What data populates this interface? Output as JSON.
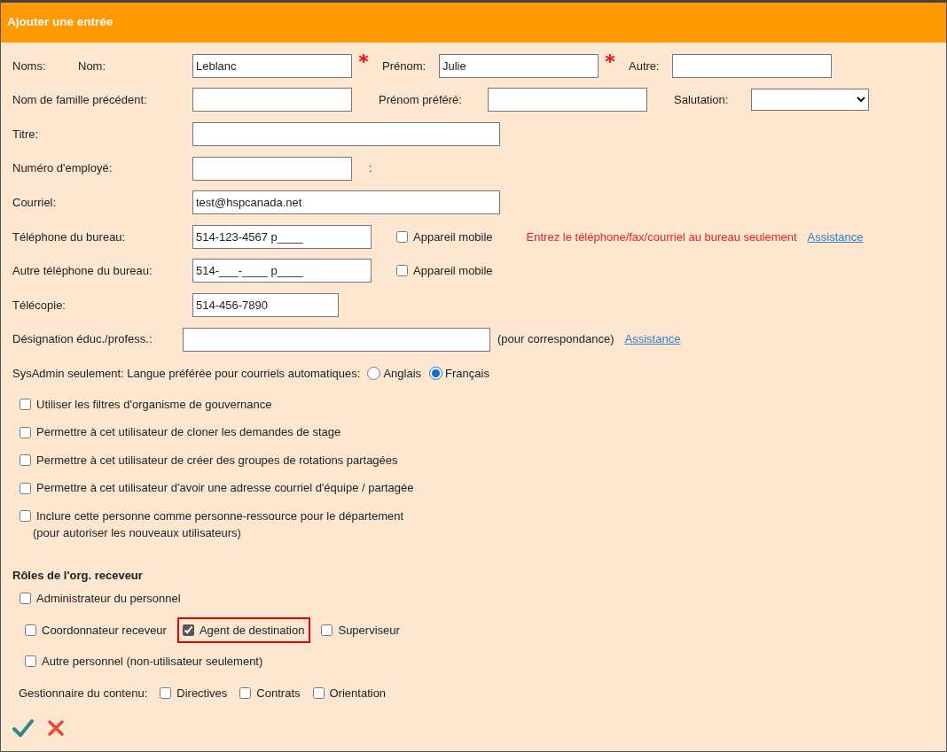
{
  "window": {
    "title": "Ajouter une entrée"
  },
  "rows": [
    {
      "items": [
        {
          "kind": "label",
          "text": "Noms:"
        },
        {
          "kind": "label",
          "text": "Nom:"
        },
        {
          "kind": "input",
          "value": "Leblanc",
          "required": true
        },
        {
          "kind": "label",
          "text": "Prénom:"
        },
        {
          "kind": "input",
          "value": "Julie",
          "required": true
        },
        {
          "kind": "label",
          "text": "Autre:"
        },
        {
          "kind": "input"
        }
      ]
    },
    {
      "items": [
        {
          "kind": "label",
          "text": "Nom de famille précédent:"
        },
        {
          "kind": "input"
        },
        {
          "kind": "label",
          "text": "Prénom préféré:"
        },
        {
          "kind": "input"
        },
        {
          "kind": "label",
          "text": "Salutation:"
        },
        {
          "kind": "select"
        }
      ]
    },
    {
      "items": [
        {
          "kind": "label",
          "text": "Titre:"
        },
        {
          "kind": "input"
        }
      ]
    },
    {
      "items": [
        {
          "kind": "label",
          "text": "Numéro d'employé:"
        },
        {
          "kind": "input"
        },
        {
          "kind": "note",
          "text": ":"
        }
      ]
    },
    {
      "items": [
        {
          "kind": "label",
          "text": "Courriel:"
        },
        {
          "kind": "input",
          "value": "test@hspcanada.net"
        }
      ]
    },
    {
      "items": [
        {
          "kind": "label",
          "text": "Téléphone du bureau:"
        },
        {
          "kind": "input",
          "value": "514-123-4567 p____"
        },
        {
          "kind": "checkbox",
          "label": "Appareil mobile",
          "checked": false
        },
        {
          "kind": "warning",
          "text": "Entrez le téléphone/fax/courriel au bureau seulement"
        },
        {
          "kind": "link",
          "text": "Assistance"
        }
      ]
    },
    {
      "items": [
        {
          "kind": "label",
          "text": "Autre téléphone du bureau:"
        },
        {
          "kind": "input",
          "value": "514-___-____ p____"
        },
        {
          "kind": "checkbox",
          "label": "Appareil mobile",
          "checked": false
        }
      ]
    },
    {
      "items": [
        {
          "kind": "label",
          "text": "Télécopie:"
        },
        {
          "kind": "input",
          "value": "514-456-7890"
        }
      ]
    },
    {
      "items": [
        {
          "kind": "label",
          "text": "Désignation éduc./profess.:"
        },
        {
          "kind": "input"
        },
        {
          "kind": "note",
          "text": "(pour correspondance)"
        },
        {
          "kind": "link",
          "text": "Assistance"
        }
      ]
    },
    {
      "items": [
        {
          "kind": "label",
          "text": "SysAdmin seulement: Langue préférée pour courriels automatiques:"
        },
        {
          "kind": "radio",
          "label": "Anglais",
          "selected": false
        },
        {
          "kind": "radio",
          "label": "Français",
          "selected": true
        }
      ]
    }
  ],
  "options": [
    {
      "label": "Utiliser les filtres d'organisme de gouvernance",
      "checked": false
    },
    {
      "label": "Permettre à cet utilisateur de cloner les demandes de stage",
      "checked": false
    },
    {
      "label": "Permettre à cet utilisateur de créer des groupes de rotations partagées",
      "checked": false
    },
    {
      "label": "Permettre à cet utilisateur d'avoir une adresse courriel d'équipe / partagée",
      "checked": false
    },
    {
      "label": "Inclure cette personne comme personne-ressource pour le département",
      "note": "(pour autoriser les nouveaux utilisateurs)",
      "checked": false
    }
  ],
  "roles": {
    "title": "Rôles de l'org. receveur",
    "rows": [
      {
        "items": [
          {
            "label": "Administrateur du personnel",
            "checked": false
          }
        ]
      },
      {
        "items": [
          {
            "label": "Coordonnateur receveur",
            "checked": false
          },
          {
            "label": "Agent de destination",
            "checked": true,
            "highlighted": true
          },
          {
            "label": "Superviseur",
            "checked": false
          }
        ]
      },
      {
        "items": [
          {
            "label": "Autre personnel (non-utilisateur seulement)",
            "checked": false
          }
        ]
      }
    ],
    "content_manager": {
      "label": "Gestionnaire du contenu:",
      "items": [
        {
          "label": "Directives",
          "checked": false
        },
        {
          "label": "Contrats",
          "checked": false
        },
        {
          "label": "Orientation",
          "checked": false
        }
      ]
    }
  },
  "actions": [
    {
      "kind": "save"
    },
    {
      "kind": "cancel"
    }
  ]
}
